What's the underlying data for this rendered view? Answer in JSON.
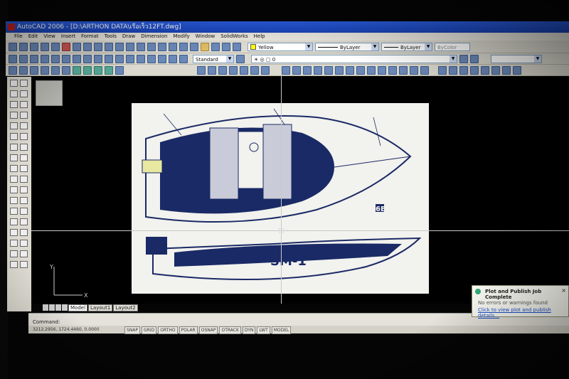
{
  "window": {
    "title": "AutoCAD 2006 - [D:\\ARTHON DATA\\เรือเร็ว12FT.dwg]"
  },
  "menu": [
    "File",
    "Edit",
    "View",
    "Insert",
    "Format",
    "Tools",
    "Draw",
    "Dimension",
    "Modify",
    "Window",
    "SolidWorks",
    "Help"
  ],
  "properties": {
    "color": "Yellow",
    "linetype": "ByLayer",
    "lineweight": "ByLayer",
    "plotstyle": "ByColor",
    "textstyle": "Standard",
    "layer": "0"
  },
  "blueprint": {
    "title": "SM-1",
    "sheet": "6B"
  },
  "layout_tabs": [
    "Model",
    "Layout1",
    "Layout2"
  ],
  "active_tab": "Model",
  "ucs": {
    "x": "X",
    "y": "Y"
  },
  "command": {
    "prompt": "Command:"
  },
  "status": {
    "coords": "3212.2956, 1724.4460, 0.0000",
    "modes": [
      "SNAP",
      "GRID",
      "ORTHO",
      "POLAR",
      "OSNAP",
      "OTRACK",
      "DYN",
      "LWT",
      "MODEL"
    ]
  },
  "notification": {
    "title": "Plot and Publish Job Complete",
    "message": "No errors or warnings found",
    "link": "Click to view plot and publish details..."
  },
  "colors": {
    "titlebar": "#1a44b8",
    "canvas": "#000000",
    "blueprint_ink": "#1a2a66"
  }
}
